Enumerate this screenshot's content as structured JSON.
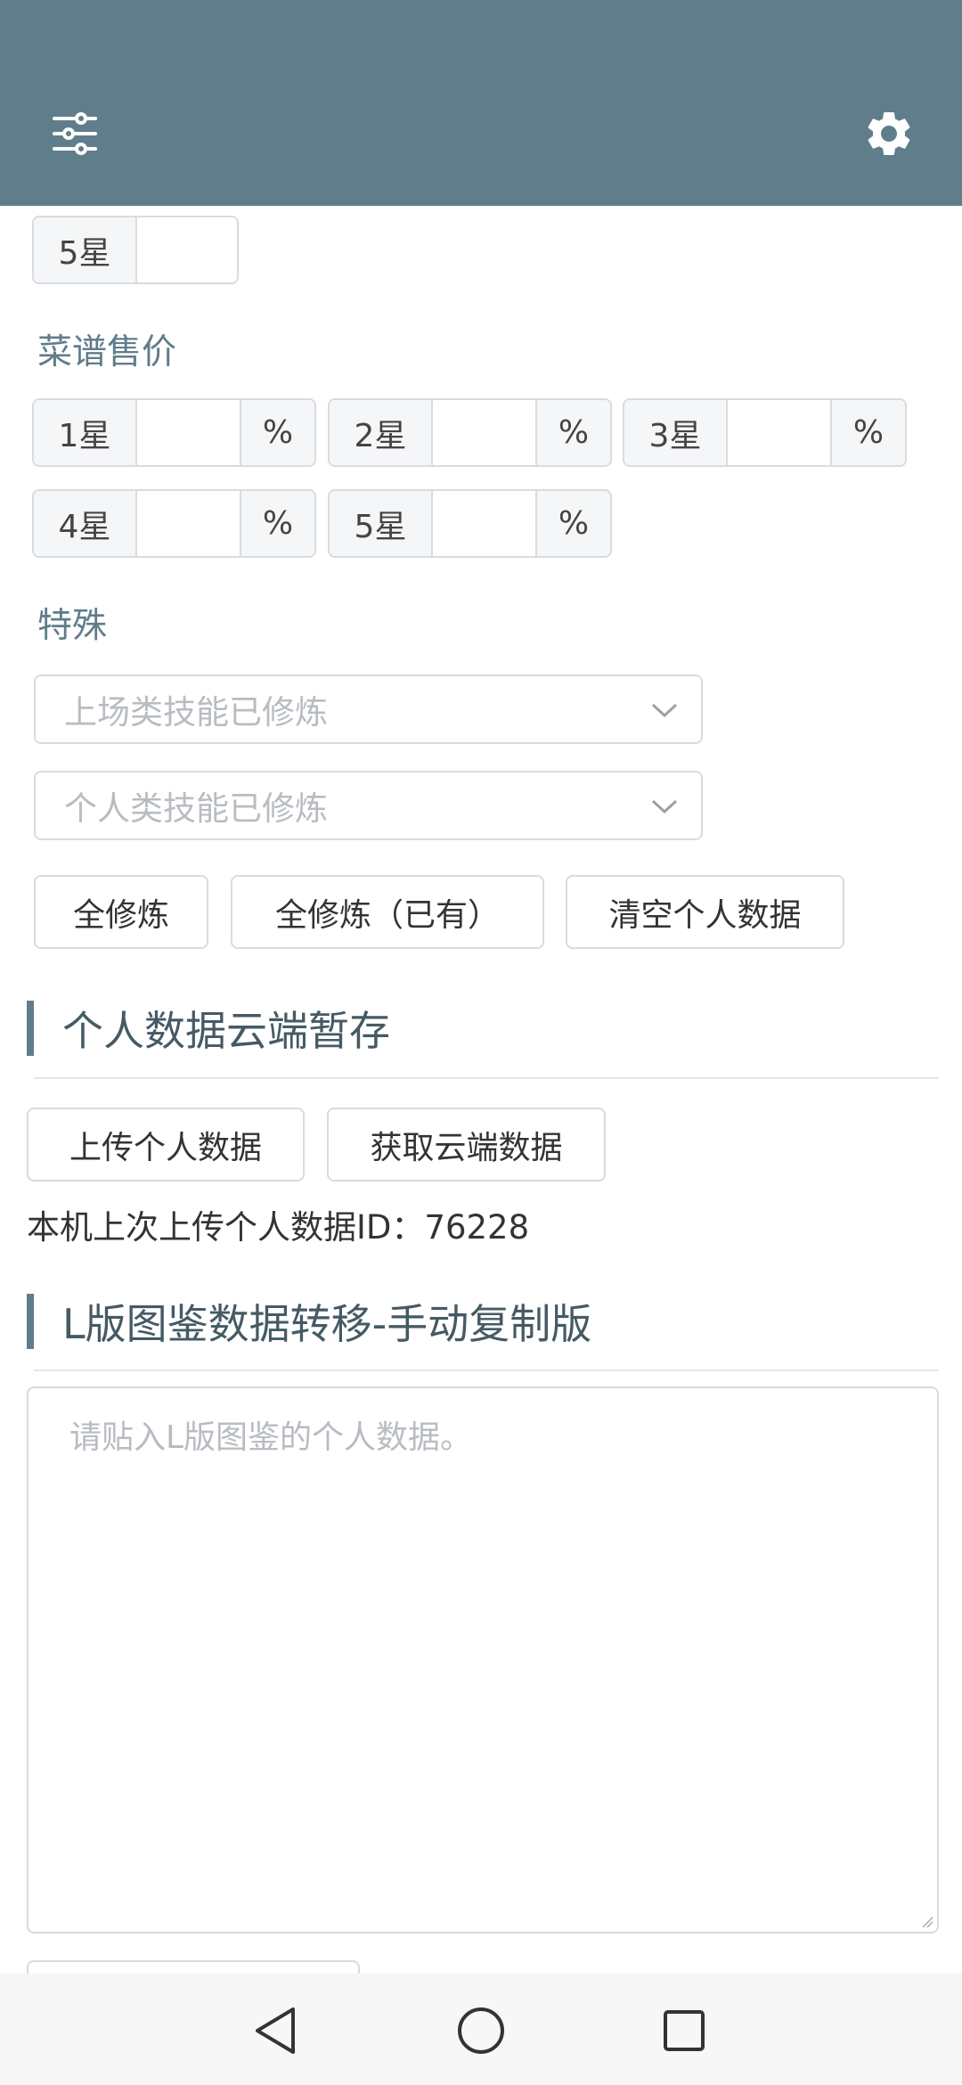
{
  "header": {
    "filter_icon": "sliders-icon",
    "settings_icon": "gear-icon",
    "bg_color": "#607d8b"
  },
  "top_row": {
    "star5_label": "5星"
  },
  "recipe_price": {
    "title": "菜谱售价",
    "stars": [
      {
        "label": "1星",
        "unit": "%"
      },
      {
        "label": "2星",
        "unit": "%"
      },
      {
        "label": "3星",
        "unit": "%"
      },
      {
        "label": "4星",
        "unit": "%"
      },
      {
        "label": "5星",
        "unit": "%"
      }
    ]
  },
  "special": {
    "title": "特殊",
    "select1_placeholder": "上场类技能已修炼",
    "select2_placeholder": "个人类技能已修炼",
    "buttons": {
      "all_train": "全修炼",
      "all_train_owned": "全修炼（已有）",
      "clear_personal": "清空个人数据"
    }
  },
  "cloud": {
    "title": "个人数据云端暂存",
    "upload_label": "上传个人数据",
    "fetch_label": "获取云端数据",
    "last_upload_text": "本机上次上传个人数据ID：76228"
  },
  "transfer": {
    "title": "L版图鉴数据转移-手动复制版",
    "textarea_placeholder": "请贴入L版图鉴的个人数据。"
  },
  "navbar": {
    "back_icon": "back-triangle-icon",
    "home_icon": "home-circle-icon",
    "recents_icon": "recents-square-icon"
  }
}
